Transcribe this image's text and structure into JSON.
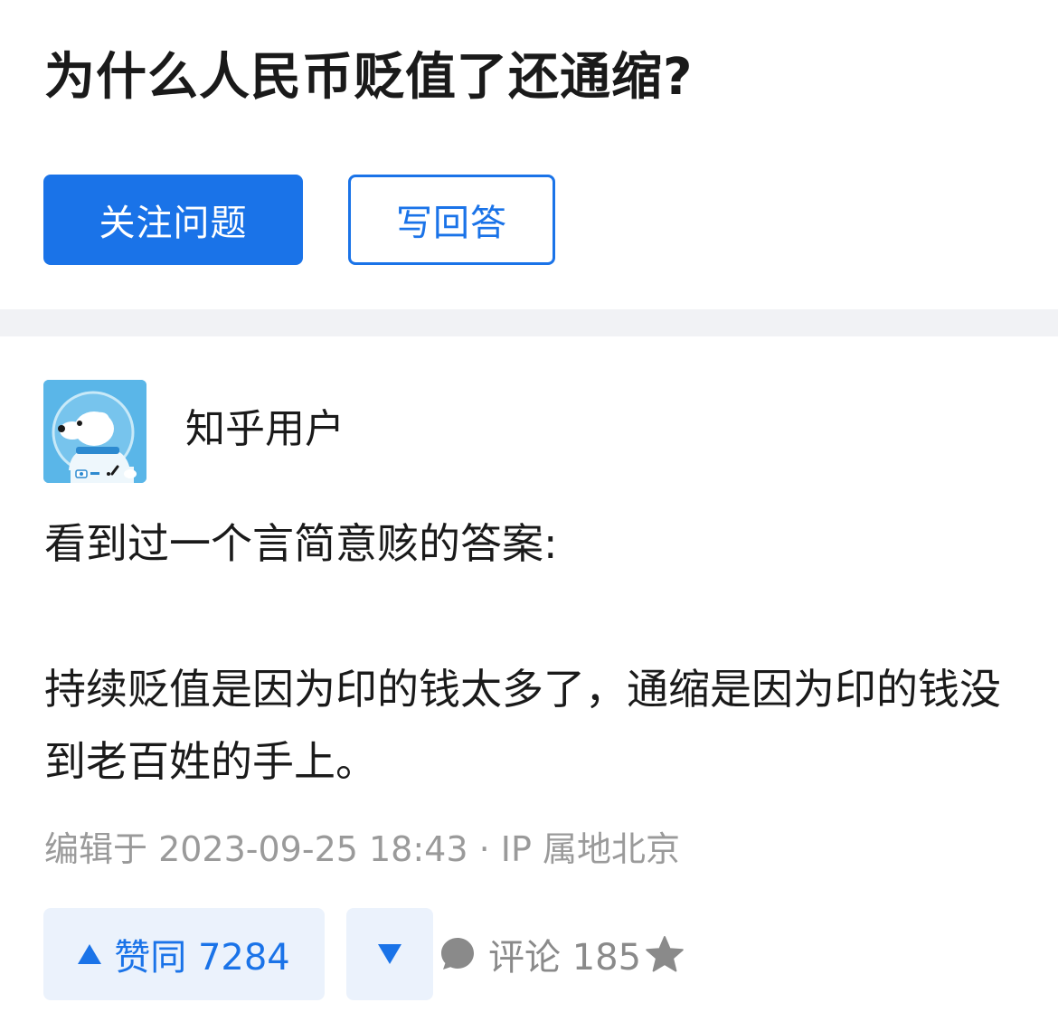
{
  "question": {
    "title": "为什么人民币贬值了还通缩?",
    "follow_label": "关注问题",
    "answer_label": "写回答"
  },
  "answer": {
    "author_name": "知乎用户",
    "intro": "看到过一个言简意赅的答案:",
    "body": "持续贬值是因为印的钱太多了，通缩是因为印的钱没到老百姓的手上。",
    "edit_meta": "编辑于 2023-09-25 18:43 · IP 属地北京"
  },
  "actions": {
    "upvote_label": "赞同 7284",
    "comment_label": "评论 185"
  },
  "colors": {
    "accent": "#1a73e8",
    "accent_light_bg": "#ebf2fc",
    "divider": "#f1f2f5",
    "meta_text": "#9a9a9a",
    "avatar_bg": "#5ab6e8"
  },
  "icons": {
    "avatar": "astronaut-dog-avatar",
    "upvote": "triangle-up-icon",
    "downvote": "triangle-down-icon",
    "comment": "comment-bubble-icon",
    "favorite": "star-icon"
  }
}
